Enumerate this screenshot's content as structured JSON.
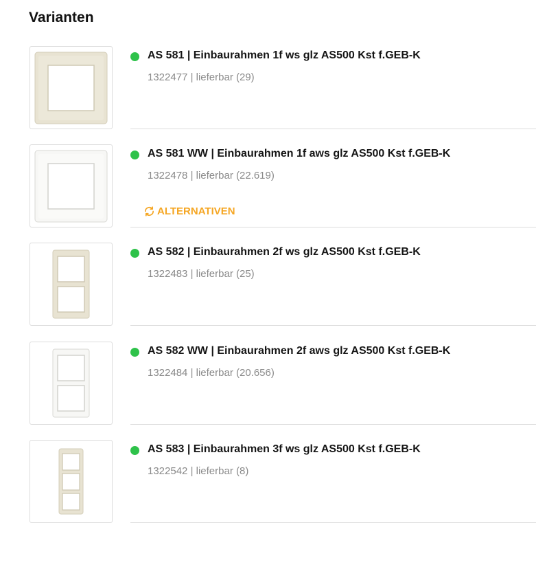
{
  "section": {
    "title": "Varianten"
  },
  "colors": {
    "status_available": "#2ec24a",
    "alternatives_accent": "#f5a623"
  },
  "variants": [
    {
      "title": "AS 581 | Einbaurahmen 1f ws glz AS500 Kst f.GEB-K",
      "meta": "1322477 | lieferbar (29)",
      "image": "frame-1f-cream"
    },
    {
      "title": "AS 581 WW | Einbaurahmen 1f aws glz AS500 Kst f.GEB-K",
      "meta": "1322478 | lieferbar (22.619)",
      "image": "frame-1f-white",
      "alternatives_label": "ALTERNATIVEN",
      "alternatives_icon": "refresh-icon"
    },
    {
      "title": "AS 582 | Einbaurahmen 2f ws glz AS500 Kst f.GEB-K",
      "meta": "1322483 | lieferbar (25)",
      "image": "frame-2f-cream"
    },
    {
      "title": "AS 582 WW | Einbaurahmen 2f aws glz AS500 Kst f.GEB-K",
      "meta": "1322484 | lieferbar (20.656)",
      "image": "frame-2f-white"
    },
    {
      "title": "AS 583 | Einbaurahmen 3f ws glz AS500 Kst f.GEB-K",
      "meta": "1322542 | lieferbar (8)",
      "image": "frame-3f-cream"
    }
  ]
}
